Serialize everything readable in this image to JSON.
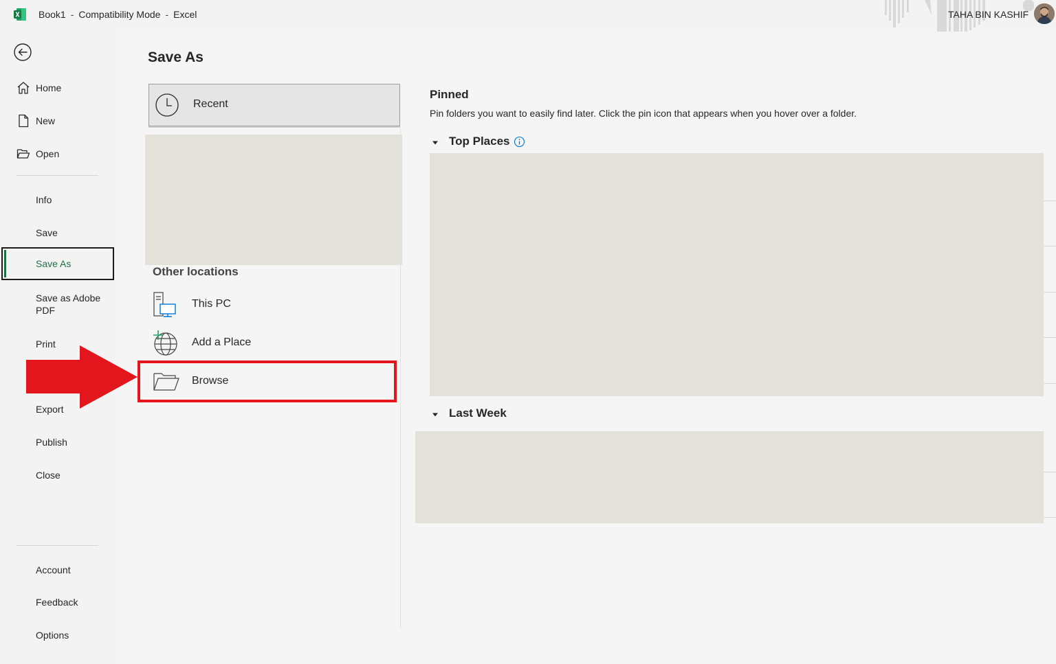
{
  "titlebar": {
    "doc_name": "Book1",
    "mode": "Compatibility Mode",
    "app_name": "Excel",
    "separator": "-",
    "user_name": "TAHA BIN KASHIF"
  },
  "nav": {
    "home": "Home",
    "new": "New",
    "open": "Open",
    "info": "Info",
    "save": "Save",
    "save_as": "Save As",
    "save_as_pdf": "Save as Adobe PDF",
    "print": "Print",
    "export": "Export",
    "publish": "Publish",
    "close": "Close",
    "account": "Account",
    "feedback": "Feedback",
    "options": "Options"
  },
  "main": {
    "title": "Save As",
    "recent_label": "Recent",
    "other_locations": "Other locations",
    "this_pc": "This PC",
    "add_place": "Add a Place",
    "browse": "Browse"
  },
  "pinned": {
    "title": "Pinned",
    "description": "Pin folders you want to easily find later. Click the pin icon that appears when you hover over a folder.",
    "top_places": "Top Places",
    "last_week": "Last Week"
  },
  "colors": {
    "accent": "#1e7145",
    "highlight": "#e3161e",
    "placeholder": "#e2e2da"
  },
  "icons": {
    "back": "arrow-left-circle-icon",
    "home": "home-icon",
    "new": "document-icon",
    "open": "folder-open-icon",
    "recent": "clock-icon",
    "this_pc": "computer-icon",
    "add_place": "globe-plus-icon",
    "browse": "folder-icon",
    "info": "info-circle-icon"
  }
}
